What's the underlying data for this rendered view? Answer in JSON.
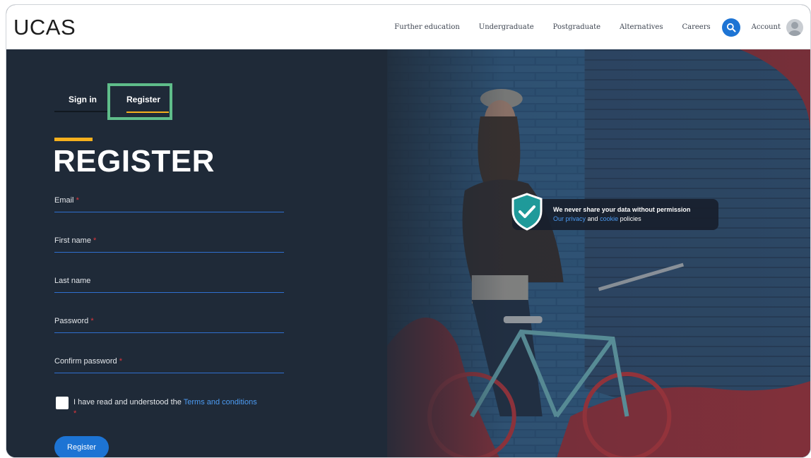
{
  "header": {
    "logo": "UCAS",
    "nav": [
      "Further education",
      "Undergraduate",
      "Postgraduate",
      "Alternatives",
      "Careers"
    ],
    "account_label": "Account"
  },
  "tabs": {
    "signin": "Sign in",
    "register": "Register"
  },
  "form": {
    "title": "REGISTER",
    "fields": [
      {
        "label": "Email",
        "required": "*"
      },
      {
        "label": "First name",
        "required": "*"
      },
      {
        "label": "Last name",
        "required": ""
      },
      {
        "label": "Password",
        "required": "*"
      },
      {
        "label": "Confirm password",
        "required": "*"
      }
    ],
    "terms_text": "I have read and understood the",
    "terms_link": "Terms and conditions",
    "terms_required": "*",
    "submit": "Register"
  },
  "privacy": {
    "headline": "We never share your data without permission",
    "link1": "Our privacy",
    "and": "and",
    "link2": "cookie",
    "suffix": "policies"
  },
  "colors": {
    "accent_blue": "#1d74d4",
    "accent_yellow": "#f6b01d",
    "highlight_green": "#5fbd8a",
    "background": "#1f2a38"
  }
}
